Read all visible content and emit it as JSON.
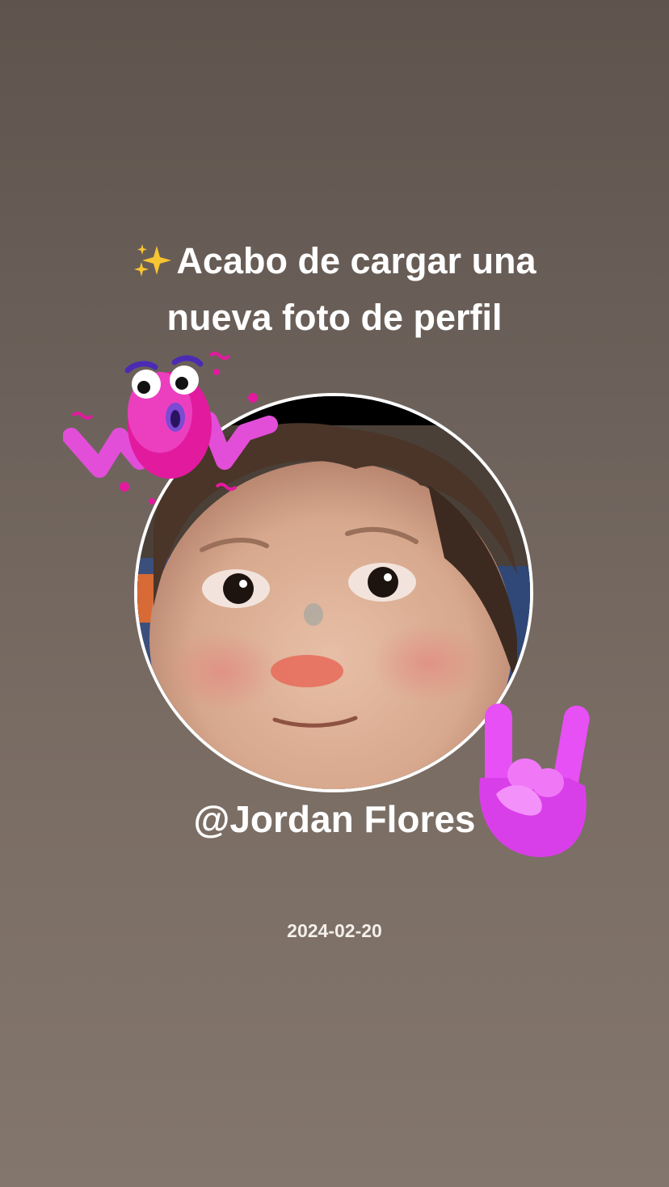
{
  "headline": {
    "line1": "Acabo de cargar una",
    "line2": "nueva foto de perfil",
    "leading_icon": "sparkles-icon"
  },
  "avatar": {
    "description_icon": "profile-photo",
    "border_color": "#ffffff"
  },
  "stickers": {
    "top_left": "wow-sticker",
    "bottom_right": "rock-hand-sticker",
    "sticker_color": "#e34fe0"
  },
  "user": {
    "handle": "@Jordan Flores"
  },
  "post": {
    "date": "2024-02-20"
  },
  "colors": {
    "background_top": "#5f544d",
    "background_bottom": "#83766c",
    "text": "#ffffff"
  }
}
